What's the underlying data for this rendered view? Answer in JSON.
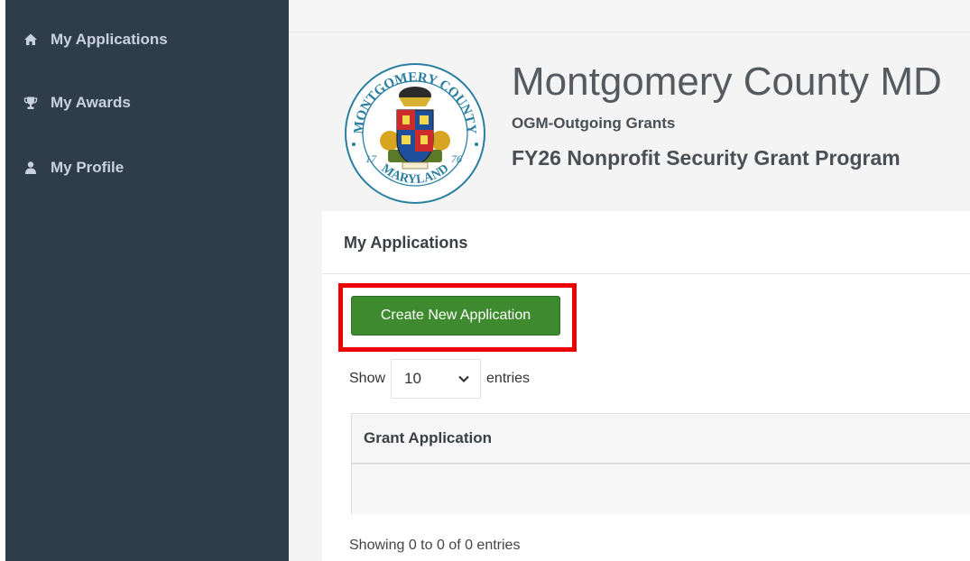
{
  "sidebar": {
    "items": [
      {
        "label": "My Applications",
        "icon": "home-icon"
      },
      {
        "label": "My Awards",
        "icon": "trophy-icon"
      },
      {
        "label": "My Profile",
        "icon": "user-icon"
      }
    ]
  },
  "header": {
    "org_title": "Montgomery County MD",
    "org_subtitle": "OGM-Outgoing Grants",
    "program_title": "FY26 Nonprofit Security Grant Program",
    "seal": {
      "top_text": "MONTGOMERY COUNTY",
      "bottom_text": "MARYLAND",
      "left_year": "17",
      "right_year": "76"
    }
  },
  "panel": {
    "title": "My Applications",
    "create_button_label": "Create New Application",
    "length": {
      "prefix": "Show",
      "selected": "10",
      "suffix": "entries"
    },
    "table": {
      "columns": [
        "Grant Application"
      ],
      "rows": []
    },
    "info": "Showing 0 to 0 of 0 entries"
  },
  "colors": {
    "sidebar_bg": "#2f3d4b",
    "sidebar_text": "#c9d2dc",
    "button_green": "#3e8a2e",
    "highlight_red": "#ee0000"
  }
}
